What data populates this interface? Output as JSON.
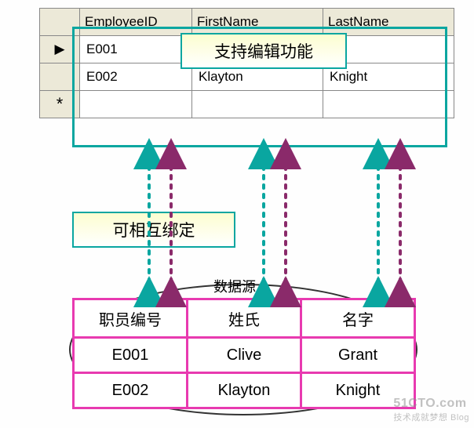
{
  "topGrid": {
    "headers": {
      "id": "EmployeeID",
      "fn": "FirstName",
      "ln": "LastName"
    },
    "rowMarkers": {
      "current": "▶",
      "new": "*"
    },
    "rows": [
      {
        "id": "E001",
        "fn": "",
        "ln": ""
      },
      {
        "id": "E002",
        "fn": "Klayton",
        "ln": "Knight"
      }
    ]
  },
  "callouts": {
    "edit": "支持编辑功能",
    "bind": "可相互绑定"
  },
  "dataSourceLabel": "数据源",
  "bottomTable": {
    "headers": {
      "id": "职员编号",
      "fn": "姓氏",
      "ln": "名字"
    },
    "rows": [
      {
        "id": "E001",
        "fn": "Clive",
        "ln": "Grant"
      },
      {
        "id": "E002",
        "fn": "Klayton",
        "ln": "Knight"
      }
    ]
  },
  "watermark": {
    "line1": "51CTO.com",
    "line2": "技术成就梦想  Blog"
  },
  "arrowColors": {
    "teal": "#0aa6a0",
    "purple": "#8a2a6a"
  }
}
